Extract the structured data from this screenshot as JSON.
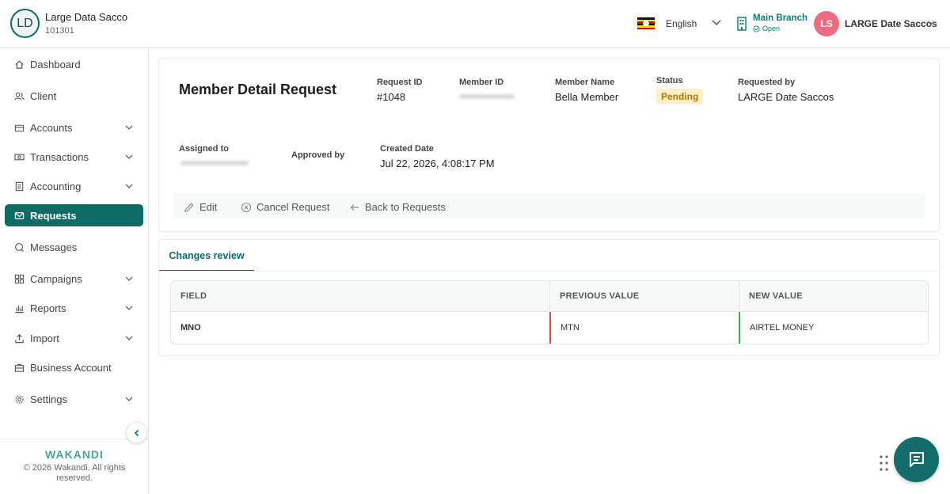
{
  "header": {
    "org_initials": "LD",
    "org_name": "Large Data Sacco",
    "org_code": "101301",
    "language": "English",
    "branch_name": "Main Branch",
    "branch_status": "Open",
    "user_initials": "LS",
    "user_name": "LARGE Date Saccos"
  },
  "sidebar": {
    "items": [
      {
        "label": "Dashboard",
        "icon": "home-icon"
      },
      {
        "label": "Client",
        "icon": "users-icon"
      },
      {
        "label": "Accounts",
        "icon": "wallet-icon",
        "expandable": true
      },
      {
        "label": "Transactions",
        "icon": "cash-icon",
        "expandable": true
      },
      {
        "label": "Accounting",
        "icon": "ledger-icon",
        "expandable": true
      },
      {
        "label": "Requests",
        "icon": "mail-icon",
        "active": true
      },
      {
        "label": "Messages",
        "icon": "chat-icon"
      },
      {
        "label": "Campaigns",
        "icon": "grid-icon",
        "expandable": true
      },
      {
        "label": "Reports",
        "icon": "bar-chart-icon",
        "expandable": true
      },
      {
        "label": "Import",
        "icon": "upload-icon",
        "expandable": true
      },
      {
        "label": "Business Account",
        "icon": "briefcase-icon"
      },
      {
        "label": "Settings",
        "icon": "gear-icon",
        "expandable": true
      }
    ],
    "brand": "WAKANDI",
    "copyright": "© 2026 Wakandi. All rights reserved."
  },
  "request": {
    "title": "Member Detail Request",
    "request_id_label": "Request ID",
    "request_id": "#1048",
    "member_id_label": "Member ID",
    "member_name_label": "Member Name",
    "member_name": "Bella Member",
    "status_label": "Status",
    "status": "Pending",
    "requested_by_label": "Requested by",
    "requested_by": "LARGE Date Saccos",
    "assigned_to_label": "Assigned to",
    "approved_by_label": "Approved by",
    "created_date_label": "Created Date",
    "created_date": "Jul 22, 2026, 4:08:17 PM"
  },
  "actions": {
    "edit": "Edit",
    "cancel": "Cancel Request",
    "back": "Back to Requests"
  },
  "changes": {
    "tab": "Changes review",
    "columns": [
      "FIELD",
      "PREVIOUS VALUE",
      "NEW VALUE"
    ],
    "rows": [
      {
        "field": "MNO",
        "previous": "MTN",
        "new": "AIRTEL MONEY"
      }
    ]
  },
  "colors": {
    "primary": "#0f6b66",
    "avatar": "#ef6b81",
    "pending_bg": "#fdf0c6",
    "previous_marker": "#e04848",
    "new_marker": "#3fae5a"
  }
}
